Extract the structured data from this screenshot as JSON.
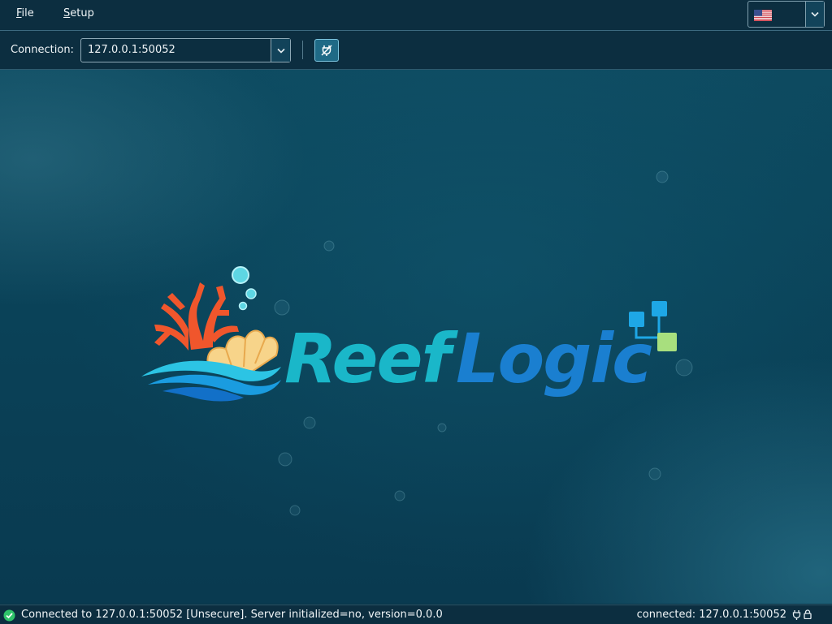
{
  "menu": {
    "file": {
      "mnemonic": "F",
      "rest": "ile"
    },
    "setup": {
      "mnemonic": "S",
      "rest": "etup"
    }
  },
  "language": {
    "selected_icon": "us-flag-icon"
  },
  "toolbar": {
    "connection_label": "Connection:",
    "connection_value": "127.0.0.1:50052",
    "disconnect_icon": "plug-disconnect-icon"
  },
  "logo": {
    "part1": "Reef",
    "part2": "Logic"
  },
  "status": {
    "message": "Connected to 127.0.0.1:50052 [Unsecure]. Server initialized=no, version=0.0.0",
    "right": "connected: 127.0.0.1:50052"
  },
  "colors": {
    "bar_bg": "#0c2e40",
    "accent": "#1f6a86",
    "logo_teal": "#1ab7c9",
    "logo_blue": "#1a7fd0",
    "ok_green": "#2fc46a"
  }
}
